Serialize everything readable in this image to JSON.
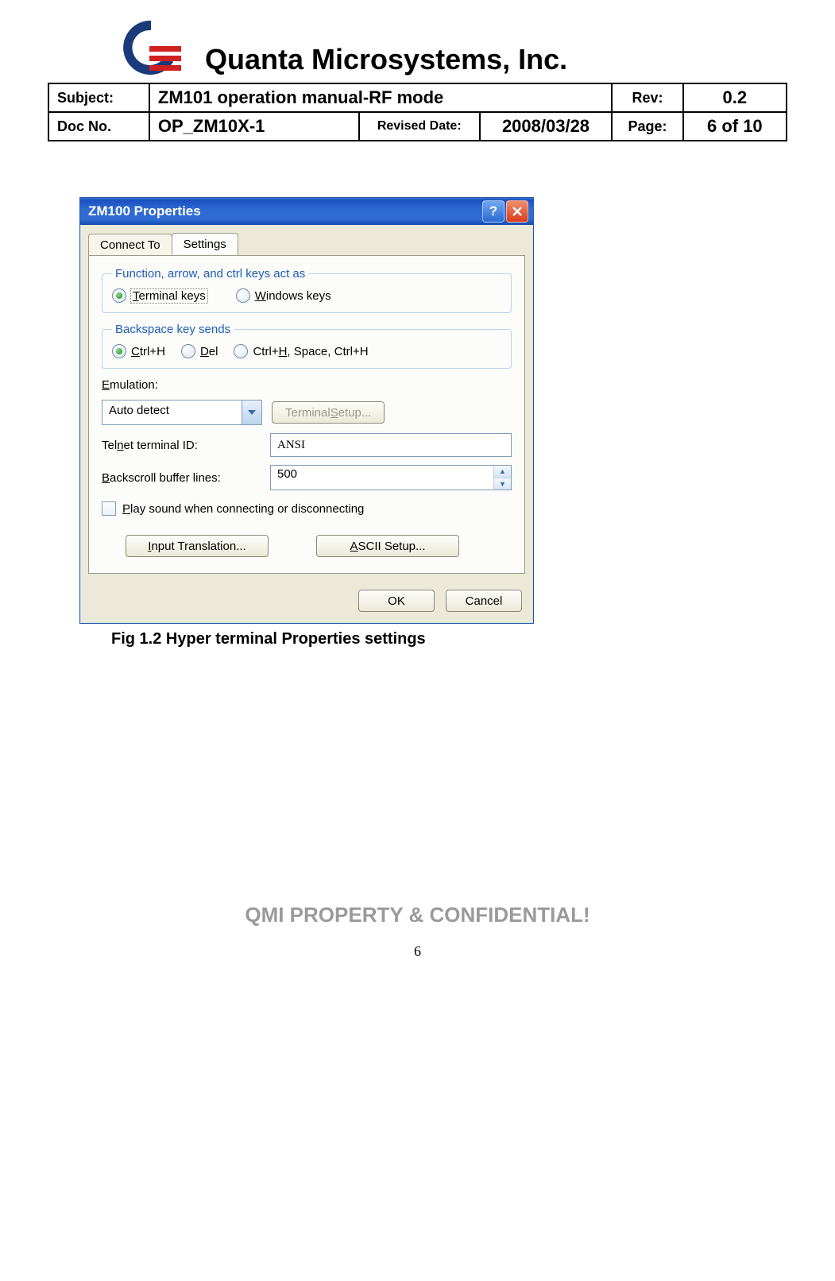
{
  "company": "Quanta Microsystems, Inc.",
  "meta": {
    "subject_lbl": "Subject:",
    "subject": "ZM101 operation manual-RF mode",
    "rev_lbl": "Rev:",
    "rev": "0.2",
    "docno_lbl": "Doc No.",
    "docno": "OP_ZM10X-1",
    "revised_lbl": "Revised Date:",
    "revised": "2008/03/28",
    "page_lbl": "Page:",
    "page": "6 of 10"
  },
  "dialog": {
    "title": "ZM100 Properties",
    "tabs": {
      "connect": "Connect To",
      "settings": "Settings"
    },
    "group1": {
      "legend": "Function, arrow, and ctrl keys act as",
      "opt1_pre": "T",
      "opt1_rest": "erminal keys",
      "opt2_pre": "W",
      "opt2_rest": "indows keys"
    },
    "group2": {
      "legend": "Backspace key sends",
      "opt1_pre": "C",
      "opt1_rest": "trl+H",
      "opt2_pre": "D",
      "opt2_rest": "el",
      "opt3_text": "Ctrl+",
      "opt3_u": "H",
      "opt3_rest": ", Space, Ctrl+H"
    },
    "emulation_lbl_pre": "E",
    "emulation_lbl_rest": "mulation:",
    "emulation_val": "Auto detect",
    "term_setup_btn": "Terminal ",
    "term_setup_u": "S",
    "term_setup_rest": "etup...",
    "telnet_lbl": "Tel",
    "telnet_u": "n",
    "telnet_rest": "et terminal ID:",
    "telnet_val": "ANSI",
    "backscroll_lbl_pre": "B",
    "backscroll_lbl_rest": "ackscroll buffer lines:",
    "backscroll_val": "500",
    "play_sound_pre": "P",
    "play_sound_rest": "lay sound when connecting or disconnecting",
    "input_trans_btn_pre": "I",
    "input_trans_btn_rest": "nput Translation...",
    "ascii_btn_pre": "A",
    "ascii_btn_rest": "SCII Setup...",
    "ok": "OK",
    "cancel": "Cancel"
  },
  "caption": "Fig 1.2 Hyper terminal Properties settings",
  "footer": "QMI PROPERTY & CONFIDENTIAL!",
  "pagenum": "6"
}
